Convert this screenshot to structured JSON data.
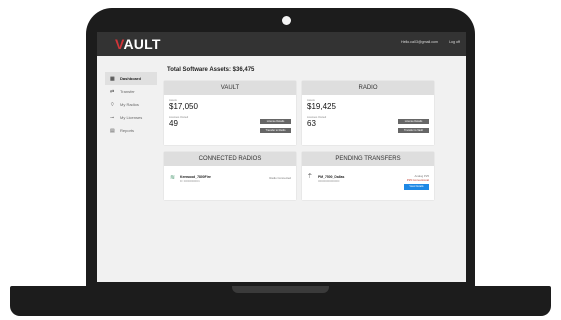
{
  "app": {
    "logo_prefix": "V",
    "logo_rest": "AULT"
  },
  "header": {
    "user_email": "Hello.ca03@gmail.com",
    "logout": "Log off"
  },
  "sidebar": {
    "items": [
      {
        "label": "Dashboard",
        "icon": "grid-icon",
        "active": true
      },
      {
        "label": "Transfer",
        "icon": "transfer-icon",
        "active": false
      },
      {
        "label": "My Radios",
        "icon": "radio-icon",
        "active": false
      },
      {
        "label": "My Licenses",
        "icon": "key-icon",
        "active": false
      },
      {
        "label": "Reports",
        "icon": "report-icon",
        "active": false
      }
    ]
  },
  "main": {
    "title": "Total Software Assets: $36,475"
  },
  "vault_card": {
    "title": "VAULT",
    "assets_label": "Assets",
    "assets_value": "$17,050",
    "licenses_label": "Licenses Owned",
    "licenses_value": "49",
    "btn_license_details": "License Details",
    "btn_transfer": "Transfer to Radio"
  },
  "radio_card": {
    "title": "RADIO",
    "assets_label": "Assets",
    "assets_value": "$19,425",
    "licenses_label": "Licenses Owned",
    "licenses_value": "63",
    "btn_license_details": "License Details",
    "btn_transfer": "Transfer to Vault"
  },
  "connected_card": {
    "title": "CONNECTED RADIOS",
    "row": {
      "name": "Kenwood_7800Fire",
      "sub": "ID: 000000000001",
      "status": "Radio Connected"
    }
  },
  "pending_card": {
    "title": "PENDING TRANSFERS",
    "row": {
      "name": "PM_7500_Dallas",
      "sub": "0000000000000000",
      "status1": "Analog P25",
      "status2": "P25 Conventional",
      "button": "View Details"
    }
  },
  "colors": {
    "topbar": "#333333",
    "accent_red": "#d13438",
    "button_blue": "#1e88e5",
    "radio_icon": "#3b8f63"
  }
}
